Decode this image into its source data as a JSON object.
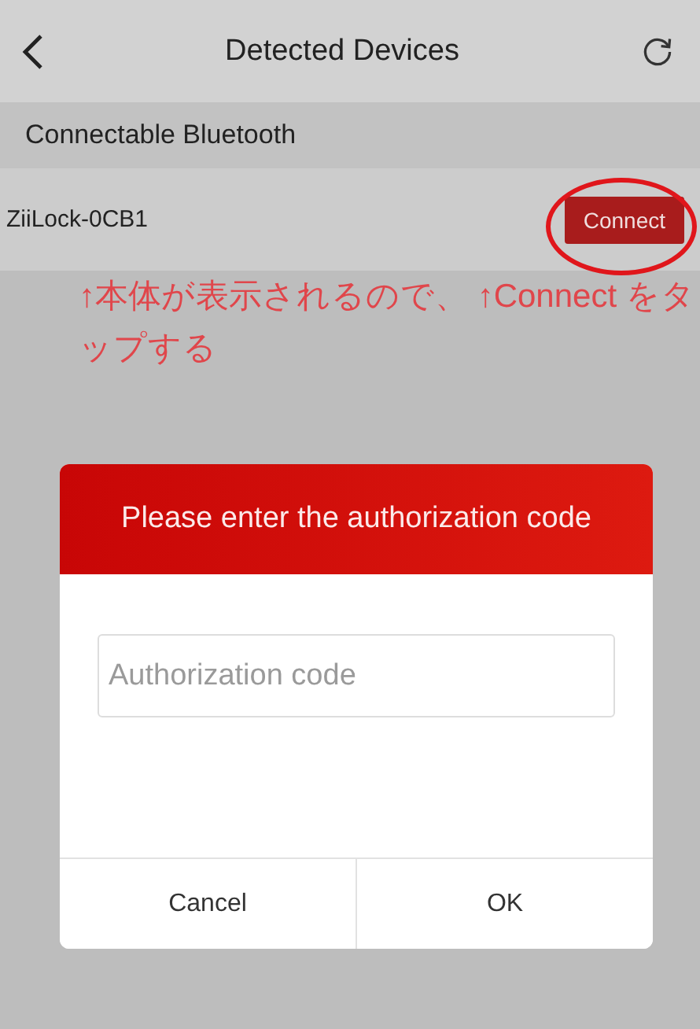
{
  "header": {
    "title": "Detected Devices"
  },
  "section": {
    "title": "Connectable Bluetooth"
  },
  "devices": [
    {
      "name": "ZiiLock-0CB1",
      "button": "Connect",
      "circled": true
    }
  ],
  "annotation": {
    "text": "↑本体が表示されるので、 ↑Connect をタップする"
  },
  "dialog": {
    "title": "Please enter the authorization code",
    "placeholder": "Authorization code",
    "buttons": [
      "Cancel",
      "OK"
    ]
  }
}
